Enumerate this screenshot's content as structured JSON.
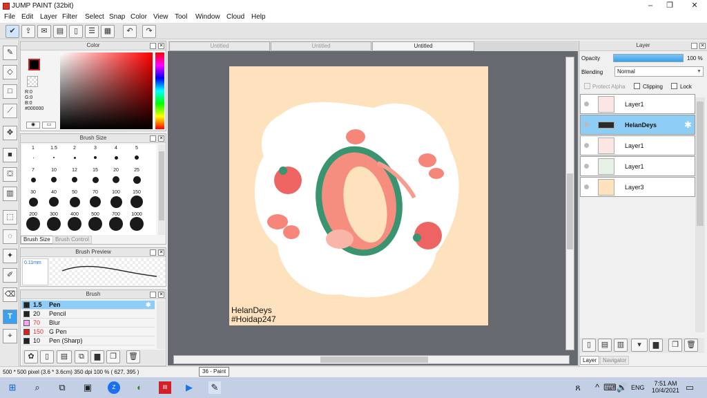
{
  "window": {
    "title": "JUMP PAINT (32bit)",
    "minimize": "–",
    "maximize": "❐",
    "close": "✕"
  },
  "menu": [
    "File",
    "Edit",
    "Layer",
    "Filter",
    "Select",
    "Snap",
    "Color",
    "View",
    "Tool",
    "Window",
    "Cloud",
    "Help"
  ],
  "panels": {
    "color": {
      "title": "Color",
      "r": "R:0",
      "g": "G:0",
      "b": "B:0",
      "hex": "#000000"
    },
    "brush_size": {
      "title": "Brush Size",
      "sizes": [
        "1",
        "1.5",
        "2",
        "3",
        "4",
        "5",
        "7",
        "10",
        "12",
        "15",
        "20",
        "25",
        "30",
        "40",
        "50",
        "70",
        "100",
        "150",
        "200",
        "300",
        "400",
        "500",
        "700",
        "1000"
      ],
      "tab_active": "Brush Size",
      "tab_inactive": "Brush Control"
    },
    "brush_preview": {
      "title": "Brush Preview",
      "size": "0.11mm"
    },
    "brush": {
      "title": "Brush",
      "items": [
        {
          "size": "1.5",
          "name": "Pen",
          "color": "#222222",
          "selected": true
        },
        {
          "size": "20",
          "name": "Pencil",
          "color": "#222222"
        },
        {
          "size": "70",
          "name": "Blur",
          "color": "#f2a6f0"
        },
        {
          "size": "150",
          "name": "G Pen",
          "color": "#e02020"
        },
        {
          "size": "10",
          "name": "Pen (Sharp)",
          "color": "#222222"
        }
      ]
    }
  },
  "tabs": [
    "Untitled",
    "Untitled",
    "Untitled"
  ],
  "canvas": {
    "signature_line1": "HelanDeys",
    "signature_line2": "#Hoidap247",
    "background": "#fde2bd"
  },
  "layer_panel": {
    "title": "Layer",
    "opacity_label": "Opacity",
    "opacity_value": "100 %",
    "opacity": 1.0,
    "blending_label": "Blending",
    "blending_value": "Normal",
    "protect_alpha": "Protect Alpha",
    "clipping": "Clipping",
    "lock": "Lock",
    "layers": [
      {
        "name": "Layer1",
        "selected": false
      },
      {
        "name": "HelanDeys",
        "selected": true
      },
      {
        "name": "Layer1",
        "selected": false
      },
      {
        "name": "Layer1",
        "selected": false
      },
      {
        "name": "Layer3",
        "selected": false
      }
    ],
    "tab_layer": "Layer",
    "tab_navigator": "Navigator"
  },
  "status": {
    "info": "500 * 500 pixel  (3.6 * 3.6cm)  350 dpi  100 %  ( 627, 395 )",
    "tooltip": "36 - Paint"
  },
  "taskbar": {
    "time": "7:51 AM",
    "date": "10/4/2021",
    "lang": "ENG"
  }
}
